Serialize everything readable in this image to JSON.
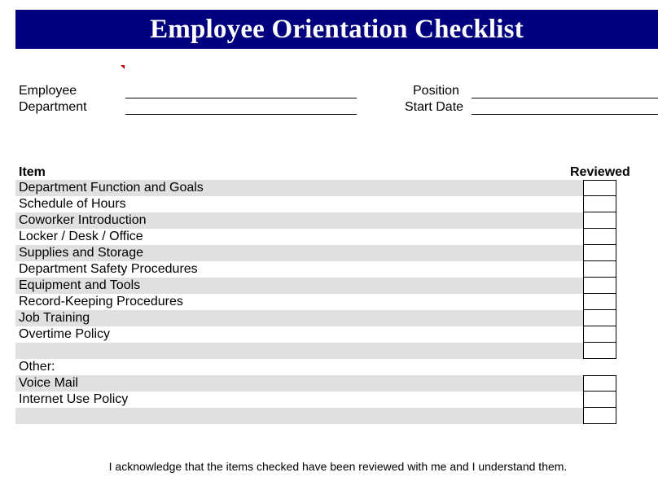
{
  "header": {
    "title": "Employee Orientation Checklist",
    "banner_color": "#00007f",
    "title_color": "#ffffff"
  },
  "fields": {
    "employee_label": "Employee",
    "employee_value": "",
    "department_label": "Department",
    "department_value": "",
    "position_label": "Position",
    "position_value": "",
    "start_date_label": "Start Date",
    "start_date_value": ""
  },
  "table": {
    "item_header": "Item",
    "reviewed_header": "Reviewed",
    "row_shade_color": "#e0e0e0",
    "rows": [
      {
        "label": "Department Function and Goals",
        "shaded": true,
        "has_box": true,
        "checked": false
      },
      {
        "label": "Schedule of Hours",
        "shaded": false,
        "has_box": true,
        "checked": false
      },
      {
        "label": "Coworker Introduction",
        "shaded": true,
        "has_box": true,
        "checked": false
      },
      {
        "label": "Locker / Desk / Office",
        "shaded": false,
        "has_box": true,
        "checked": false
      },
      {
        "label": "Supplies and Storage",
        "shaded": true,
        "has_box": true,
        "checked": false
      },
      {
        "label": "Department Safety Procedures",
        "shaded": false,
        "has_box": true,
        "checked": false
      },
      {
        "label": "Equipment and Tools",
        "shaded": true,
        "has_box": true,
        "checked": false
      },
      {
        "label": "Record-Keeping Procedures",
        "shaded": false,
        "has_box": true,
        "checked": false
      },
      {
        "label": "Job Training",
        "shaded": true,
        "has_box": true,
        "checked": false
      },
      {
        "label": "Overtime Policy",
        "shaded": false,
        "has_box": true,
        "checked": false
      },
      {
        "label": "",
        "shaded": true,
        "has_box": true,
        "checked": false
      },
      {
        "label": "Other:",
        "shaded": false,
        "has_box": false,
        "checked": false
      },
      {
        "label": "Voice Mail",
        "shaded": true,
        "has_box": true,
        "checked": false
      },
      {
        "label": "Internet Use Policy",
        "shaded": false,
        "has_box": true,
        "checked": false
      },
      {
        "label": "",
        "shaded": true,
        "has_box": true,
        "checked": false
      }
    ]
  },
  "acknowledgement": "I acknowledge that the items checked have been reviewed with me and I understand them."
}
